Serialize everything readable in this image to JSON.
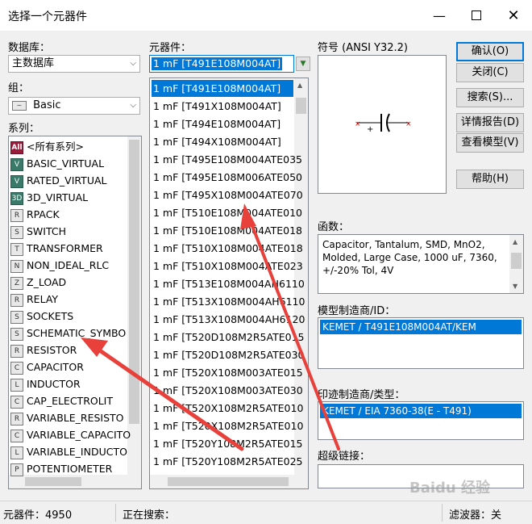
{
  "window": {
    "title": "选择一个元器件"
  },
  "labels": {
    "database": "数据库：",
    "group": "组：",
    "family": "系列：",
    "component": "元器件：",
    "symbol": "符号 (ANSI Y32.2)",
    "function": "函数：",
    "model_mfr": "模型制造商/ID：",
    "footprint_mfr": "印迹制造商/类型：",
    "hyperlink": "超级链接："
  },
  "database_combo": {
    "value": "主数据库"
  },
  "group_combo": {
    "value": "Basic"
  },
  "component_input": {
    "value": "1 mF  [T491E108M004AT]"
  },
  "families": [
    {
      "label": "<所有系列>",
      "icon": "All"
    },
    {
      "label": "BASIC_VIRTUAL",
      "icon": "V"
    },
    {
      "label": "RATED_VIRTUAL",
      "icon": "V"
    },
    {
      "label": "3D_VIRTUAL",
      "icon": "3D"
    },
    {
      "label": "RPACK",
      "icon": "R"
    },
    {
      "label": "SWITCH",
      "icon": "S"
    },
    {
      "label": "TRANSFORMER",
      "icon": "T"
    },
    {
      "label": "NON_IDEAL_RLC",
      "icon": "N"
    },
    {
      "label": "Z_LOAD",
      "icon": "Z"
    },
    {
      "label": "RELAY",
      "icon": "R"
    },
    {
      "label": "SOCKETS",
      "icon": "S"
    },
    {
      "label": "SCHEMATIC_SYMBO",
      "icon": "S"
    },
    {
      "label": "RESISTOR",
      "icon": "R"
    },
    {
      "label": "CAPACITOR",
      "icon": "C"
    },
    {
      "label": "INDUCTOR",
      "icon": "L"
    },
    {
      "label": "CAP_ELECTROLIT",
      "icon": "C"
    },
    {
      "label": "VARIABLE_RESISTO",
      "icon": "R"
    },
    {
      "label": "VARIABLE_CAPACITO",
      "icon": "C"
    },
    {
      "label": "VARIABLE_INDUCTO",
      "icon": "L"
    },
    {
      "label": "POTENTIOMETER",
      "icon": "P"
    }
  ],
  "components": [
    "1 mF  [T491E108M004AT]",
    "1 mF  [T491X108M004AT]",
    "1 mF  [T494E108M004AT]",
    "1 mF  [T494X108M004AT]",
    "1 mF  [T495E108M004ATE035",
    "1 mF  [T495E108M006ATE050",
    "1 mF  [T495X108M004ATE070",
    "1 mF  [T510E108M004ATE010",
    "1 mF  [T510E108M004ATE018",
    "1 mF  [T510X108M004ATE018",
    "1 mF  [T510X108M004ATE023",
    "1 mF  [T513E108M004AH6110",
    "1 mF  [T513X108M004AH6110",
    "1 mF  [T513X108M004AH6120",
    "1 mF  [T520D108M2R5ATE015",
    "1 mF  [T520D108M2R5ATE030",
    "1 mF  [T520X108M003ATE015",
    "1 mF  [T520X108M003ATE030",
    "1 mF  [T520X108M2R5ATE010",
    "1 mF  [T520X108M2R5ATE010",
    "1 mF  [T520Y108M2R5ATE015",
    "1 mF  [T520Y108M2R5ATE025"
  ],
  "buttons": {
    "ok": "确认(O)",
    "close": "关闭(C)",
    "search": "搜索(S)...",
    "detail": "详情报告(D)",
    "model": "查看模型(V)",
    "help": "帮助(H)"
  },
  "function_text": "Capacitor, Tantalum, SMD, MnO2, Molded, Large Case, 1000 uF, 7360, +/-20% Tol, 4V",
  "model_mfr_value": "KEMET / T491E108M004AT/KEM",
  "footprint_value": "KEMET / EIA 7360-38(E - T491)",
  "status": {
    "count": "元器件：4950",
    "searching": "正在搜索：",
    "filter": "滤波器：关"
  },
  "watermark": "Baidu 经验",
  "colors": {
    "selection": "#0078d7",
    "annotation": "#e8403a"
  }
}
